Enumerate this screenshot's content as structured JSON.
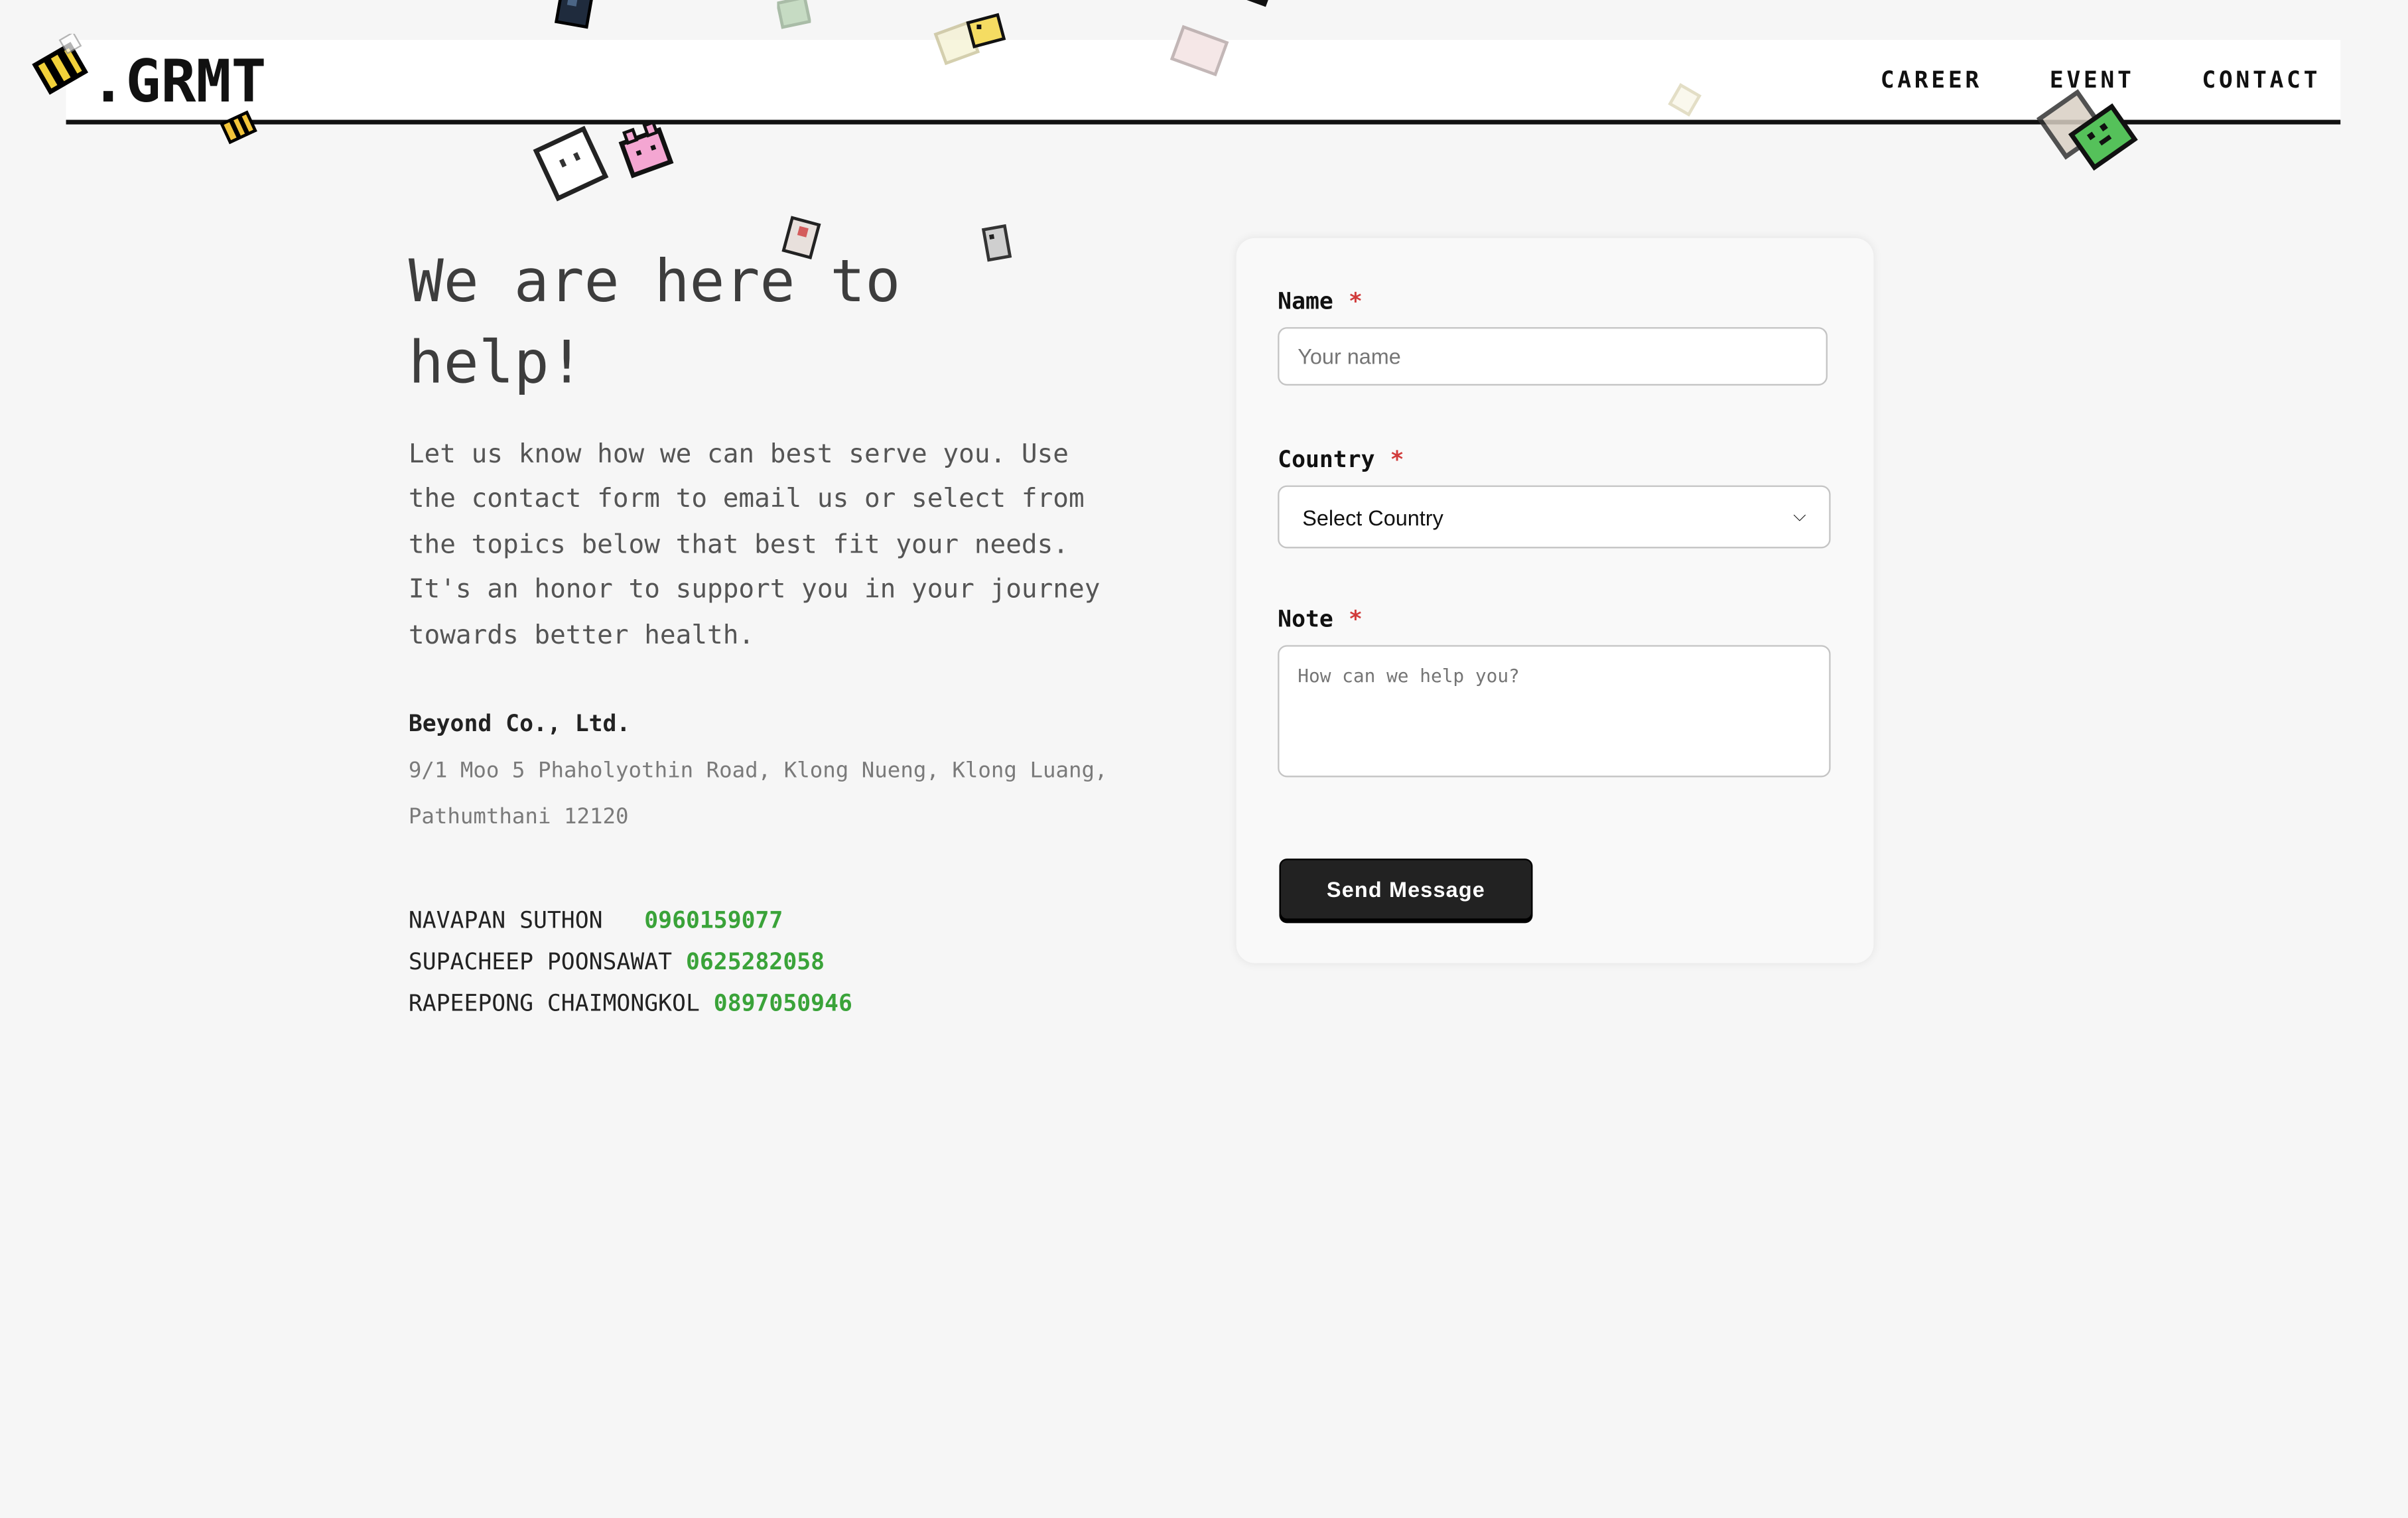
{
  "header": {
    "logo": ".GRMT",
    "nav": [
      {
        "label": "CAREER"
      },
      {
        "label": "EVENT"
      },
      {
        "label": "CONTACT"
      }
    ]
  },
  "hero": {
    "title": "We are here to help!",
    "intro": "Let us know how we can best serve you. Use the contact form to email us or select from the topics below that best fit your needs. It's an honor to support you in your journey towards better health."
  },
  "company": {
    "name": "Beyond Co., Ltd.",
    "address": "9/1 Moo 5 Phaholyothin Road, Klong Nueng, Klong Luang, Pathumthani 12120"
  },
  "contacts": [
    {
      "name": "NAVAPAN SUTHON  ",
      "phone": "0960159077"
    },
    {
      "name": "SUPACHEEP POONSAWAT",
      "phone": "0625282058"
    },
    {
      "name": "RAPEEPONG CHAIMONGKOL",
      "phone": "0897050946"
    }
  ],
  "form": {
    "name_label": "Name",
    "name_placeholder": "Your name",
    "country_label": "Country",
    "country_selected": "Select Country",
    "note_label": "Note",
    "note_placeholder": "How can we help you?",
    "required_mark": "*",
    "submit_label": "Send Message"
  },
  "colors": {
    "background": "#f6f6f6",
    "accent_green": "#3aa339",
    "required_red": "#d13b3b",
    "button_dark": "#222222"
  },
  "decorations": {
    "sprites": [
      "bee-sprite",
      "ghost-sprite",
      "pink-pig-sprite",
      "cat-sprite",
      "green-dino-sprite"
    ]
  }
}
